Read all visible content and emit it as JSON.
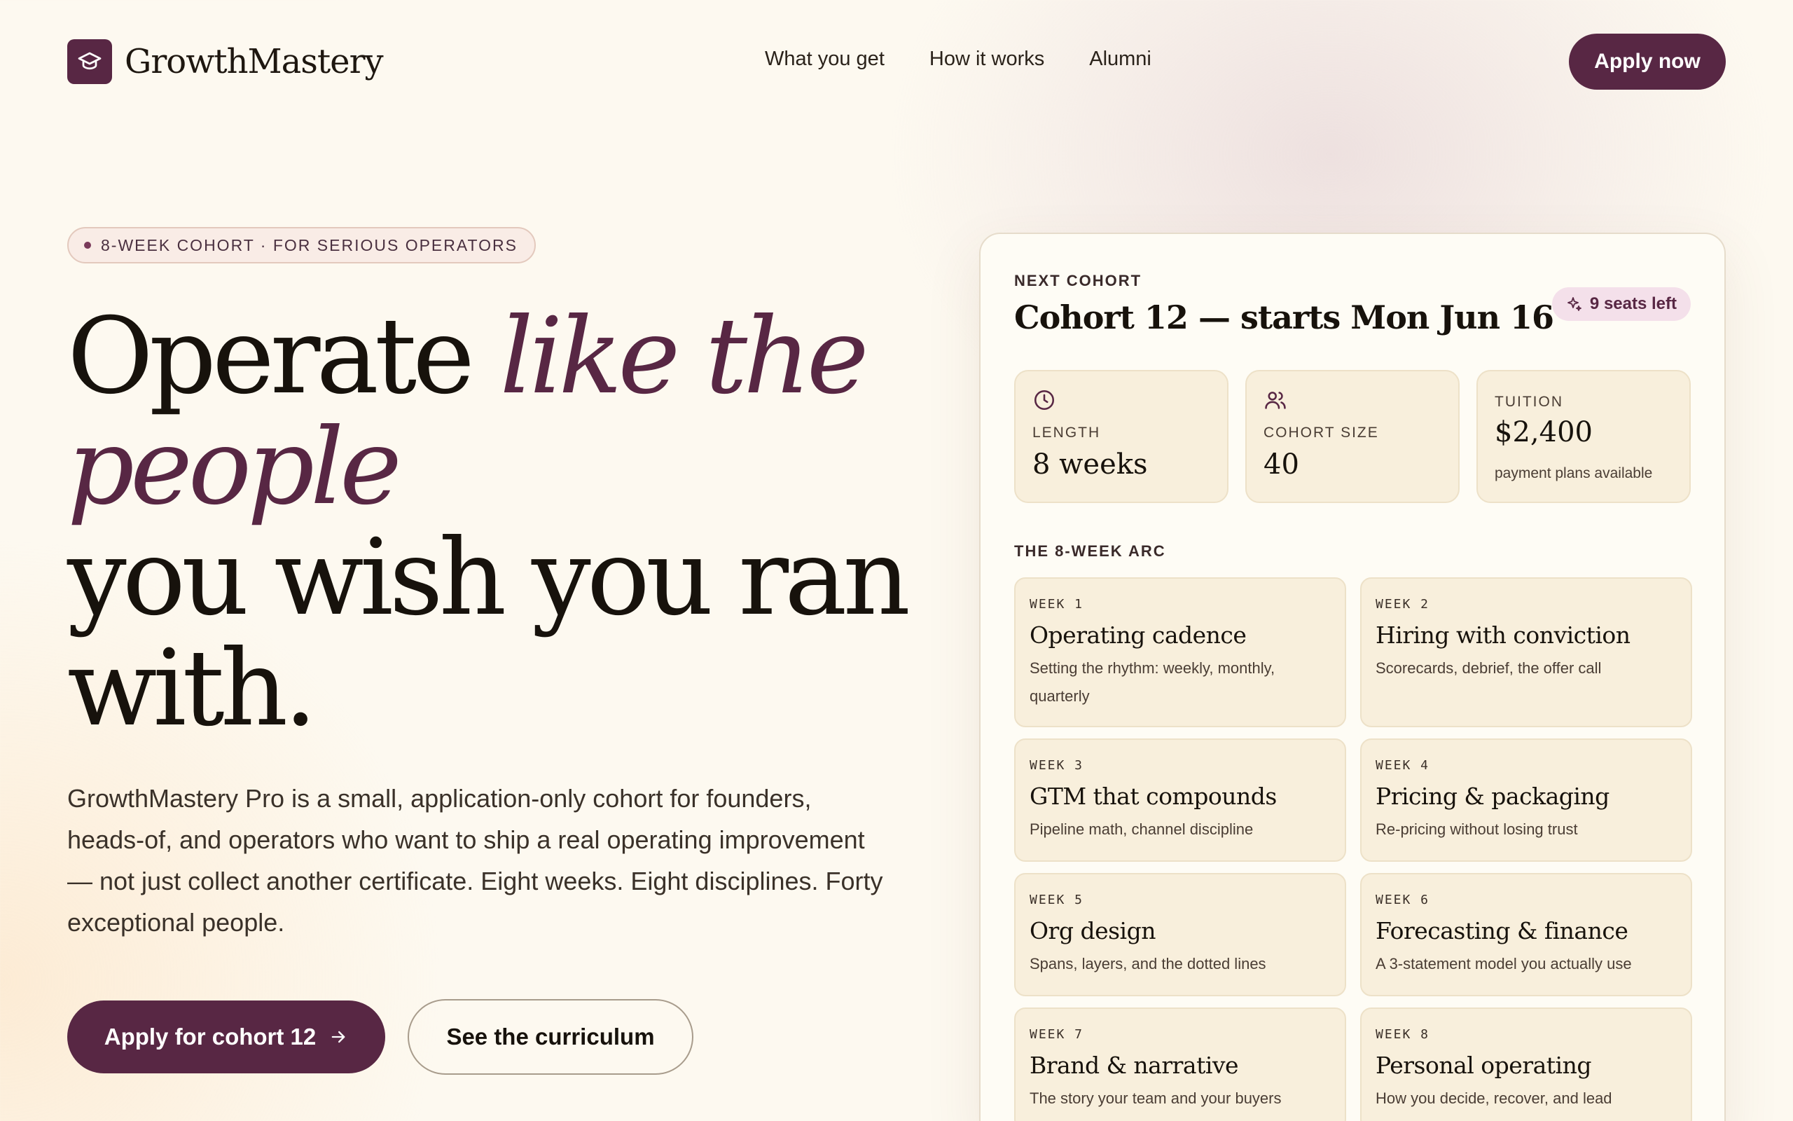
{
  "brand": {
    "name": "GrowthMastery",
    "logo_icon": "graduation-cap-icon",
    "accent": "#582744"
  },
  "nav": {
    "links": [
      "What you get",
      "How it works",
      "Alumni"
    ],
    "cta": "Apply now"
  },
  "hero": {
    "badge": "8-WEEK COHORT · FOR SERIOUS OPERATORS",
    "headline": {
      "part1": "Operate ",
      "accent": "like the people",
      "part2": "you wish you ran with."
    },
    "lead": "GrowthMastery Pro is a small, application-only cohort for founders, heads-of, and operators who want to ship a real operating improvement — not just collect another certificate. Eight weeks. Eight disciplines. Forty exceptional people.",
    "cta_primary": "Apply for cohort 12",
    "cta_secondary": "See the curriculum"
  },
  "cohort": {
    "eyebrow": "NEXT COHORT",
    "title": "Cohort 12 — starts Mon Jun 16",
    "seats": "9 seats left",
    "stats": [
      {
        "icon": "clock-icon",
        "label": "LENGTH",
        "value": "8 weeks"
      },
      {
        "icon": "users-icon",
        "label": "COHORT SIZE",
        "value": "40"
      },
      {
        "label": "TUITION",
        "value": "$2,400",
        "note": "payment plans available"
      }
    ],
    "arc_title": "THE 8-WEEK ARC",
    "weeks": [
      {
        "num": "WEEK 1",
        "title": "Operating cadence",
        "desc": "Setting the rhythm: weekly, monthly, quarterly"
      },
      {
        "num": "WEEK 2",
        "title": "Hiring with conviction",
        "desc": "Scorecards, debrief, the offer call"
      },
      {
        "num": "WEEK 3",
        "title": "GTM that compounds",
        "desc": "Pipeline math, channel discipline"
      },
      {
        "num": "WEEK 4",
        "title": "Pricing & packaging",
        "desc": "Re-pricing without losing trust"
      },
      {
        "num": "WEEK 5",
        "title": "Org design",
        "desc": "Spans, layers, and the dotted lines"
      },
      {
        "num": "WEEK 6",
        "title": "Forecasting & finance",
        "desc": "A 3-statement model you actually use"
      },
      {
        "num": "WEEK 7",
        "title": "Brand & narrative",
        "desc": "The story your team and your buyers"
      },
      {
        "num": "WEEK 8",
        "title": "Personal operating",
        "desc": "How you decide, recover, and lead"
      }
    ]
  }
}
